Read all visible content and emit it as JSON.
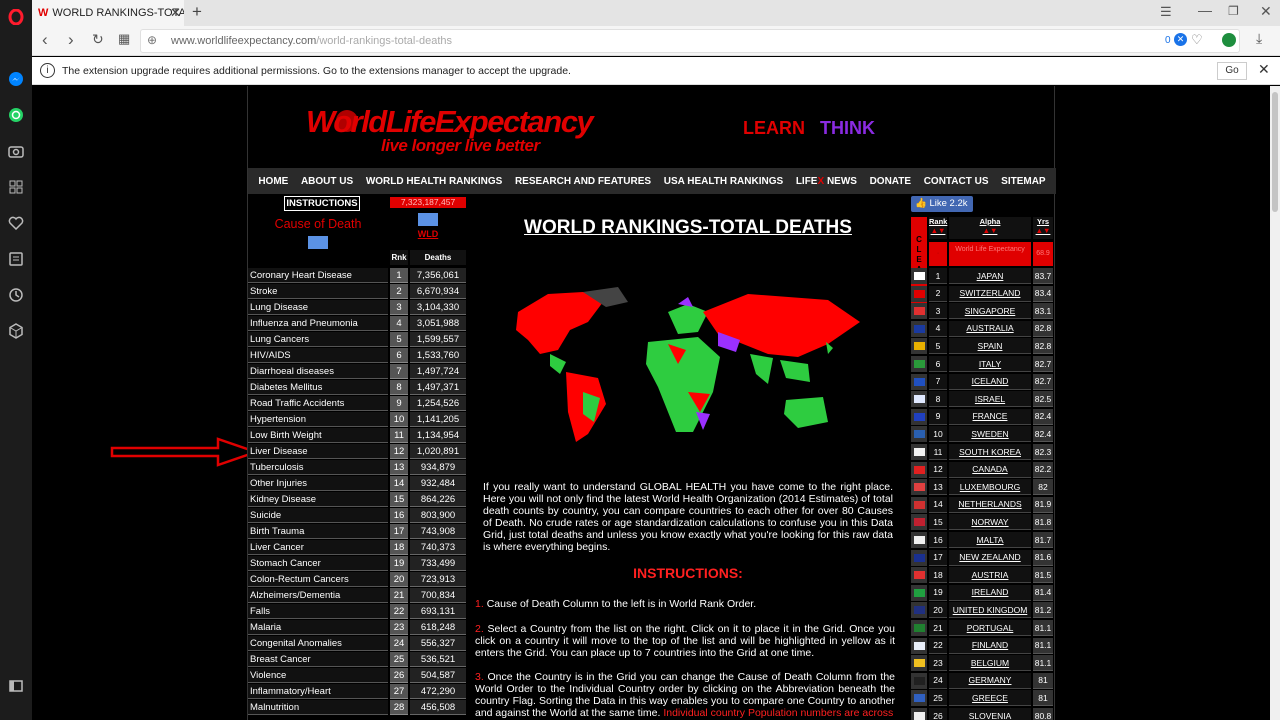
{
  "browser": {
    "tab_title": "WORLD RANKINGS-TOTAL D",
    "url_domain": "www.worldlifeexpectancy.com",
    "url_path": "/world-rankings-total-deaths",
    "adblock_count": "0",
    "info_message": "The extension upgrade requires additional permissions. Go to the extensions manager to accept the upgrade.",
    "go_label": "Go"
  },
  "site": {
    "logo_main": "WorldLifeExpectancy",
    "logo_tag": "live longer live better",
    "learn": "LEARN",
    "think": "THINK",
    "nav": [
      "HOME",
      "ABOUT US",
      "WORLD HEALTH RANKINGS",
      "RESEARCH AND FEATURES",
      "USA HEALTH RANKINGS",
      "LIFE",
      "X",
      "NEWS",
      "DONATE",
      "CONTACT US",
      "SITEMAP"
    ],
    "instructions_btn": "INSTRUCTIONS",
    "cause_heading": "Cause of Death",
    "world_total": "7,323,187,457",
    "wld": "WLD",
    "rnk_header": "Rnk",
    "deaths_header": "Deaths",
    "page_title": "WORLD RANKINGS-TOTAL DEATHS",
    "like": "Like 2.2k",
    "rank_header": "Rank",
    "alpha_header": "Alpha",
    "yrs_header": "Yrs",
    "clear_label": "CLEAR",
    "world_le_label": "World Life Expectancy",
    "world_le_value": "68.9",
    "intro": "If you really want to understand GLOBAL HEALTH you have come to the right place. Here you will not only find the latest World Health Organization (2014 Estimates) of total death counts by country, you can compare countries to each other for over 80 Causes of Death. No crude rates or age standardization calculations to confuse you in this Data Grid, just total deaths and unless you know exactly what you're looking for this raw data is where everything begins.",
    "instructions_title": "INSTRUCTIONS:",
    "instr1_num": "1.",
    "instr1": "Cause of Death Column to the left is in World Rank Order.",
    "instr2_num": "2.",
    "instr2": "Select a Country from the list on the right. Click on it to place it in the Grid. Once you click on a country it will move to the top of the list and will be highlighted in yellow as it enters the Grid. You can place up to 7 countries into the Grid at one time.",
    "instr3_num": "3.",
    "instr3": "Once the Country is in the Grid you can change the Cause of Death Column from the World Order to the Individual Country order by clicking on the Abbreviation beneath the country Flag. Sorting the Data in this way enables you to compare one Country to another and against the World at the same time.",
    "instr3_red": "Individual country Population numbers are across"
  },
  "causes": [
    {
      "name": "Coronary Heart Disease",
      "rank": "1",
      "deaths": "7,356,061"
    },
    {
      "name": "Stroke",
      "rank": "2",
      "deaths": "6,670,934"
    },
    {
      "name": "Lung Disease",
      "rank": "3",
      "deaths": "3,104,330"
    },
    {
      "name": "Influenza and Pneumonia",
      "rank": "4",
      "deaths": "3,051,988"
    },
    {
      "name": "Lung Cancers",
      "rank": "5",
      "deaths": "1,599,557"
    },
    {
      "name": "HIV/AIDS",
      "rank": "6",
      "deaths": "1,533,760"
    },
    {
      "name": "Diarrhoeal diseases",
      "rank": "7",
      "deaths": "1,497,724"
    },
    {
      "name": "Diabetes Mellitus",
      "rank": "8",
      "deaths": "1,497,371"
    },
    {
      "name": "Road Traffic Accidents",
      "rank": "9",
      "deaths": "1,254,526"
    },
    {
      "name": "Hypertension",
      "rank": "10",
      "deaths": "1,141,205"
    },
    {
      "name": "Low Birth Weight",
      "rank": "11",
      "deaths": "1,134,954"
    },
    {
      "name": "Liver Disease",
      "rank": "12",
      "deaths": "1,020,891"
    },
    {
      "name": "Tuberculosis",
      "rank": "13",
      "deaths": "934,879"
    },
    {
      "name": "Other Injuries",
      "rank": "14",
      "deaths": "932,484"
    },
    {
      "name": "Kidney Disease",
      "rank": "15",
      "deaths": "864,226"
    },
    {
      "name": "Suicide",
      "rank": "16",
      "deaths": "803,900"
    },
    {
      "name": "Birth Trauma",
      "rank": "17",
      "deaths": "743,908"
    },
    {
      "name": "Liver Cancer",
      "rank": "18",
      "deaths": "740,373"
    },
    {
      "name": "Stomach Cancer",
      "rank": "19",
      "deaths": "733,499"
    },
    {
      "name": "Colon-Rectum Cancers",
      "rank": "20",
      "deaths": "723,913"
    },
    {
      "name": "Alzheimers/Dementia",
      "rank": "21",
      "deaths": "700,834"
    },
    {
      "name": "Falls",
      "rank": "22",
      "deaths": "693,131"
    },
    {
      "name": "Malaria",
      "rank": "23",
      "deaths": "618,248"
    },
    {
      "name": "Congenital Anomalies",
      "rank": "24",
      "deaths": "556,327"
    },
    {
      "name": "Breast Cancer",
      "rank": "25",
      "deaths": "536,521"
    },
    {
      "name": "Violence",
      "rank": "26",
      "deaths": "504,587"
    },
    {
      "name": "Inflammatory/Heart",
      "rank": "27",
      "deaths": "472,290"
    },
    {
      "name": "Malnutrition",
      "rank": "28",
      "deaths": "456,508"
    }
  ],
  "countries": [
    {
      "rank": "1",
      "name": "JAPAN",
      "yrs": "83.7",
      "flag": "#ffffff"
    },
    {
      "rank": "2",
      "name": "SWITZERLAND",
      "yrs": "83.4",
      "flag": "#e00000"
    },
    {
      "rank": "3",
      "name": "SINGAPORE",
      "yrs": "83.1",
      "flag": "#e03030"
    },
    {
      "rank": "4",
      "name": "AUSTRALIA",
      "yrs": "82.8",
      "flag": "#1a3aa0"
    },
    {
      "rank": "5",
      "name": "SPAIN",
      "yrs": "82.8",
      "flag": "#e8b000"
    },
    {
      "rank": "6",
      "name": "ITALY",
      "yrs": "82.7",
      "flag": "#2a9a3a"
    },
    {
      "rank": "7",
      "name": "ICELAND",
      "yrs": "82.7",
      "flag": "#2050c0"
    },
    {
      "rank": "8",
      "name": "ISRAEL",
      "yrs": "82.5",
      "flag": "#dfe8ff"
    },
    {
      "rank": "9",
      "name": "FRANCE",
      "yrs": "82.4",
      "flag": "#2040c0"
    },
    {
      "rank": "10",
      "name": "SWEDEN",
      "yrs": "82.4",
      "flag": "#2a60b0"
    },
    {
      "rank": "11",
      "name": "SOUTH KOREA",
      "yrs": "82.3",
      "flag": "#f4f4f4"
    },
    {
      "rank": "12",
      "name": "CANADA",
      "yrs": "82.2",
      "flag": "#e02020"
    },
    {
      "rank": "13",
      "name": "LUXEMBOURG",
      "yrs": "82",
      "flag": "#e04040"
    },
    {
      "rank": "14",
      "name": "NETHERLANDS",
      "yrs": "81.9",
      "flag": "#d03030"
    },
    {
      "rank": "15",
      "name": "NORWAY",
      "yrs": "81.8",
      "flag": "#c02030"
    },
    {
      "rank": "16",
      "name": "MALTA",
      "yrs": "81.7",
      "flag": "#f0f0f0"
    },
    {
      "rank": "17",
      "name": "NEW ZEALAND",
      "yrs": "81.6",
      "flag": "#1a3090"
    },
    {
      "rank": "18",
      "name": "AUSTRIA",
      "yrs": "81.5",
      "flag": "#e03030"
    },
    {
      "rank": "19",
      "name": "IRELAND",
      "yrs": "81.4",
      "flag": "#20a040"
    },
    {
      "rank": "20",
      "name": "UNITED KINGDOM",
      "yrs": "81.2",
      "flag": "#203080"
    },
    {
      "rank": "21",
      "name": "PORTUGAL",
      "yrs": "81.1",
      "flag": "#208030"
    },
    {
      "rank": "22",
      "name": "FINLAND",
      "yrs": "81.1",
      "flag": "#e8eef8"
    },
    {
      "rank": "23",
      "name": "BELGIUM",
      "yrs": "81.1",
      "flag": "#f0c020"
    },
    {
      "rank": "24",
      "name": "GERMANY",
      "yrs": "81",
      "flag": "#202020"
    },
    {
      "rank": "25",
      "name": "GREECE",
      "yrs": "81",
      "flag": "#3060c0"
    },
    {
      "rank": "26",
      "name": "SLOVENIA",
      "yrs": "80.8",
      "flag": "#f0f0f0"
    }
  ],
  "colors": {
    "brand_red": "#e00000",
    "purple": "#8a2be2",
    "map_green": "#2ecc40",
    "map_red": "#ff0000",
    "map_purple": "#9b30ff",
    "arrow": "#e00000"
  }
}
